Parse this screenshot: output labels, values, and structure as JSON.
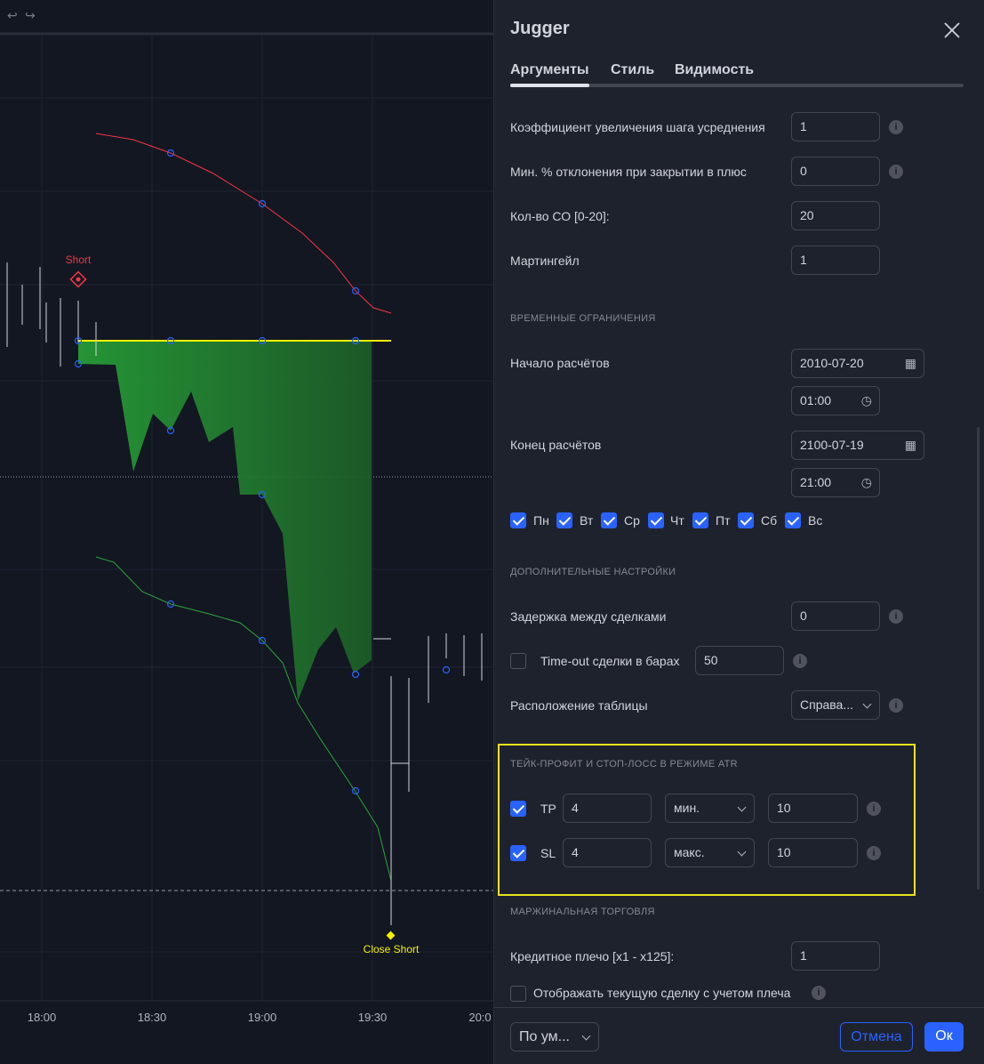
{
  "chart": {
    "time_labels": [
      "18:00",
      "18:30",
      "19:00",
      "19:30",
      "20:0"
    ],
    "short_label": "Short",
    "close_short_label": "Close Short"
  },
  "dialog": {
    "title": "Jugger",
    "tabs": [
      "Аргументы",
      "Стиль",
      "Видимость"
    ],
    "rows": [
      {
        "label": "Коэффициент увеличения шага усреднения",
        "value": "1"
      },
      {
        "label": "Мин. % отклонения при закрытии в плюс",
        "value": "0"
      },
      {
        "label": "Кол-во СО [0-20]:",
        "value": "20"
      },
      {
        "label": "Мартингейл",
        "value": "1"
      }
    ],
    "time_section": "ВРЕМЕННЫЕ ОГРАНИЧЕНИЯ",
    "start_label": "Начало расчётов",
    "start_date": "2010-07-20",
    "start_time": "01:00",
    "end_label": "Конец расчётов",
    "end_date": "2100-07-19",
    "end_time": "21:00",
    "days": [
      "Пн",
      "Вт",
      "Ср",
      "Чт",
      "Пт",
      "Сб",
      "Вс"
    ],
    "extra_section": "ДОПОЛНИТЕЛЬНЫЕ НАСТРОЙКИ",
    "delay_label": "Задержка между сделками",
    "delay_value": "0",
    "timeout_label": "Time-out сделки в барах",
    "timeout_value": "50",
    "table_label": "Расположение таблицы",
    "table_value": "Справа...",
    "atr_section": "ТЕЙК-ПРОФИТ И СТОП-ЛОСС В РЕЖИМЕ ATR",
    "tp": {
      "label": "TP",
      "value": "4",
      "mode": "мин.",
      "value2": "10"
    },
    "sl": {
      "label": "SL",
      "value": "4",
      "mode": "макс.",
      "value2": "10"
    },
    "margin_section": "МАРЖИНАЛЬНАЯ ТОРГОВЛЯ",
    "leverage_label": "Кредитное плечо [x1 - x125]:",
    "leverage_value": "1",
    "show_leverage_label": "Отображать текущую сделку с учетом плеча",
    "footer": {
      "defaults": "По ум...",
      "cancel": "Отмена",
      "ok": "Ок"
    }
  },
  "colors": {
    "accent": "#2962ff",
    "highlight": "#e8e41a"
  }
}
